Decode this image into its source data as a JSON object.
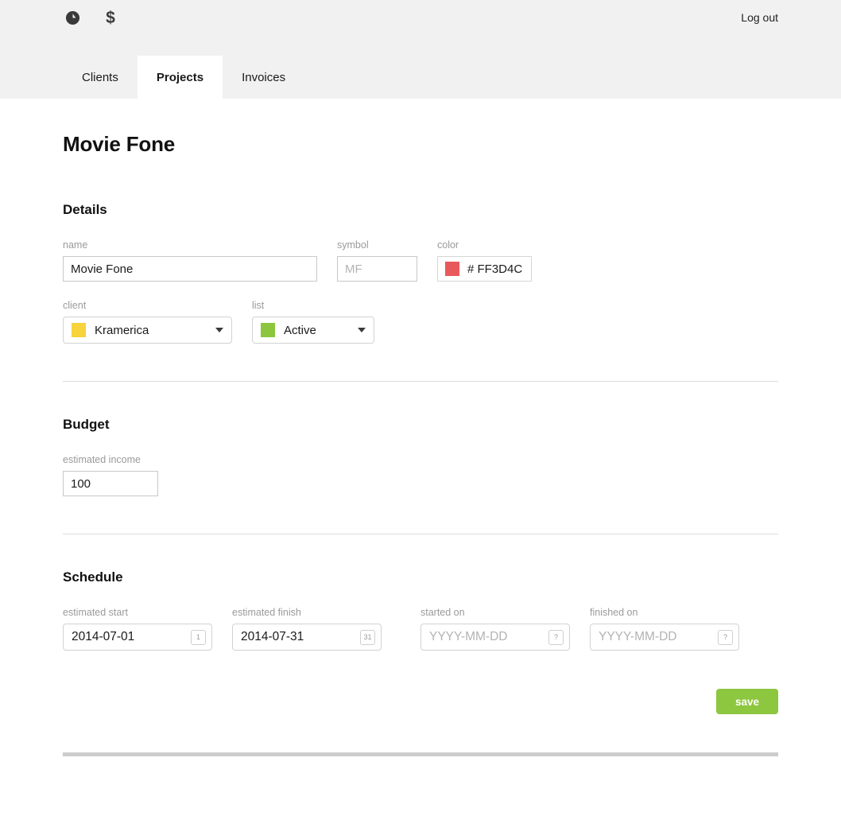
{
  "header": {
    "icons": [
      {
        "name": "clock-icon",
        "glyph": "clock"
      },
      {
        "name": "dollar-icon",
        "glyph": "$"
      }
    ],
    "logout_label": "Log out",
    "tabs": [
      {
        "label": "Clients",
        "active": false
      },
      {
        "label": "Projects",
        "active": true
      },
      {
        "label": "Invoices",
        "active": false
      }
    ]
  },
  "page": {
    "title": "Movie Fone"
  },
  "details": {
    "section_title": "Details",
    "name": {
      "label": "name",
      "value": "Movie Fone",
      "placeholder": ""
    },
    "symbol": {
      "label": "symbol",
      "value": "",
      "placeholder": "MF"
    },
    "color": {
      "label": "color",
      "value": "# FF3D4C",
      "swatch": "#e8595c"
    },
    "client": {
      "label": "client",
      "value": "Kramerica",
      "swatch": "#f7d33c"
    },
    "list": {
      "label": "list",
      "value": "Active",
      "swatch": "#8cc63e"
    }
  },
  "budget": {
    "section_title": "Budget",
    "estimated_income": {
      "label": "estimated income",
      "value": "100",
      "placeholder": ""
    }
  },
  "schedule": {
    "section_title": "Schedule",
    "estimated_start": {
      "label": "estimated start",
      "value": "2014-07-01",
      "badge": "1"
    },
    "estimated_finish": {
      "label": "estimated finish",
      "value": "2014-07-31",
      "badge": "31"
    },
    "started_on": {
      "label": "started on",
      "value": "",
      "placeholder": "YYYY-MM-DD",
      "badge": "?"
    },
    "finished_on": {
      "label": "finished on",
      "value": "",
      "placeholder": "YYYY-MM-DD",
      "badge": "?"
    }
  },
  "actions": {
    "save_label": "save"
  }
}
